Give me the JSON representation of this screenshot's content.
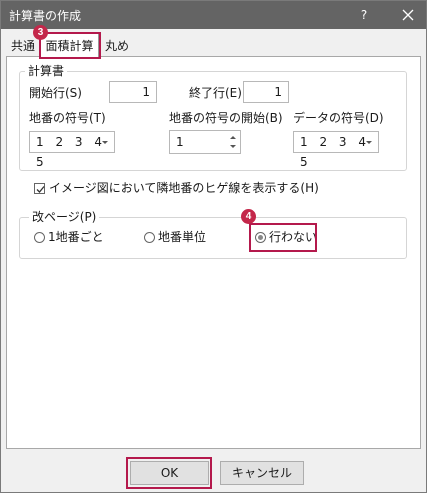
{
  "window": {
    "title": "計算書の作成",
    "help": "?"
  },
  "tabs": [
    {
      "label": "共通"
    },
    {
      "label": "面積計算"
    },
    {
      "label": "丸め"
    }
  ],
  "calc_group": {
    "title": "計算書",
    "start_row": {
      "label": "開始行(S)",
      "value": "1"
    },
    "end_row": {
      "label": "終了行(E)",
      "value": "1"
    },
    "lot_sign": {
      "label": "地番の符号(T)",
      "value": "1 2 3 4 5"
    },
    "lot_sign_start": {
      "label": "地番の符号の開始(B)",
      "value": "1"
    },
    "data_sign": {
      "label": "データの符号(D)",
      "value": "1 2 3 4 5"
    }
  },
  "image_option": {
    "label": "イメージ図において隣地番のヒゲ線を表示する(H)",
    "checked": true
  },
  "page_break": {
    "title": "改ページ(P)",
    "options": [
      {
        "label": "1地番ごと"
      },
      {
        "label": "地番単位"
      },
      {
        "label": "行わない"
      }
    ],
    "selected": "行わない"
  },
  "footer": {
    "ok_label": "OK",
    "cancel_label": "キャンセル"
  },
  "annotations": {
    "step3": "3",
    "step4": "4"
  },
  "colors": {
    "highlight": "#b4194c",
    "titlebar": "#646464"
  }
}
